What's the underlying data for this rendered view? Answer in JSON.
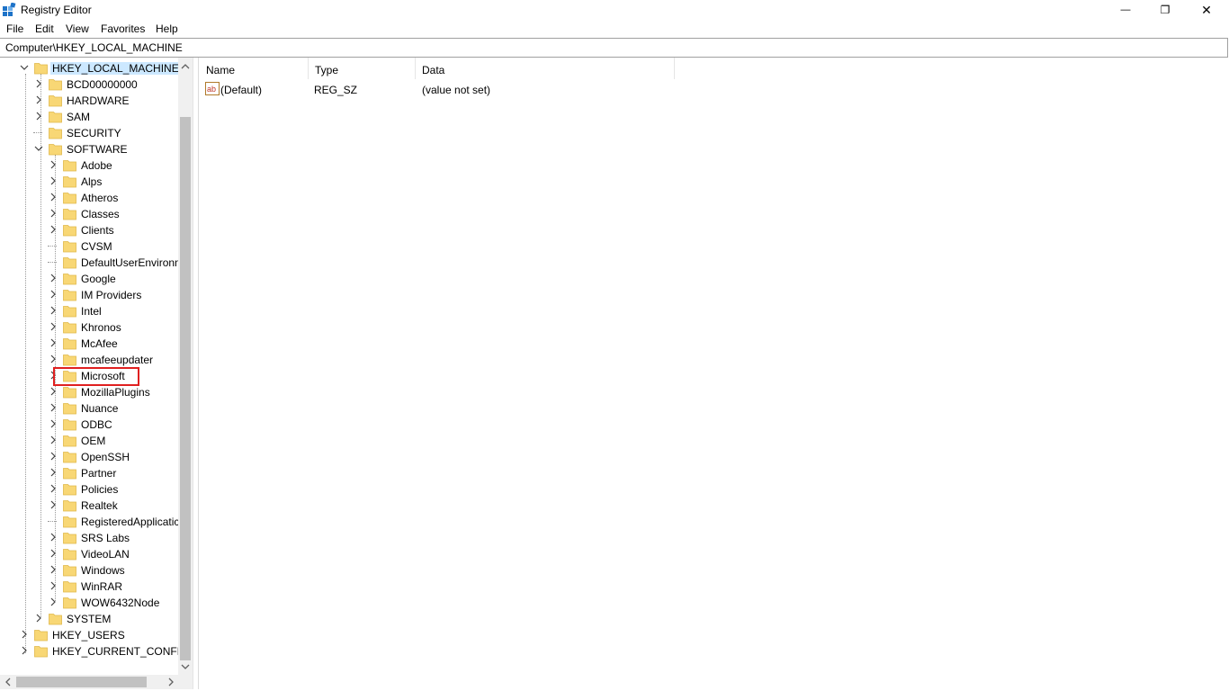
{
  "window": {
    "title": "Registry Editor",
    "icon": "registry-editor-icon",
    "minimize_glyph": "—",
    "maximize_glyph": "❐",
    "close_glyph": "✕"
  },
  "menu": {
    "file": "File",
    "edit": "Edit",
    "view": "View",
    "favorites": "Favorites",
    "help": "Help"
  },
  "address": {
    "path": "Computer\\HKEY_LOCAL_MACHINE"
  },
  "tree": {
    "hklm": "HKEY_LOCAL_MACHINE",
    "hklm_children": [
      "BCD00000000",
      "HARDWARE",
      "SAM",
      "SECURITY",
      "SOFTWARE"
    ],
    "software_children": [
      "Adobe",
      "Alps",
      "Atheros",
      "Classes",
      "Clients",
      "CVSM",
      "DefaultUserEnvironn",
      "Google",
      "IM Providers",
      "Intel",
      "Khronos",
      "McAfee",
      "mcafeeupdater",
      "Microsoft",
      "MozillaPlugins",
      "Nuance",
      "ODBC",
      "OEM",
      "OpenSSH",
      "Partner",
      "Policies",
      "Realtek",
      "RegisteredApplicatic",
      "SRS Labs",
      "VideoLAN",
      "Windows",
      "WinRAR",
      "WOW6432Node"
    ],
    "system": "SYSTEM",
    "hku": "HKEY_USERS",
    "hkcc": "HKEY_CURRENT_CONFIG",
    "highlighted": "Microsoft"
  },
  "list": {
    "columns": {
      "name": "Name",
      "type": "Type",
      "data": "Data"
    },
    "rows": [
      {
        "name": "(Default)",
        "type": "REG_SZ",
        "data": "(value not set)",
        "icon": "string-value-icon",
        "icon_text": "ab"
      }
    ]
  },
  "colors": {
    "folder": "#f8d775",
    "folder_edge": "#e0b84a",
    "selection": "#cce8ff",
    "highlight_box": "#e02020"
  }
}
